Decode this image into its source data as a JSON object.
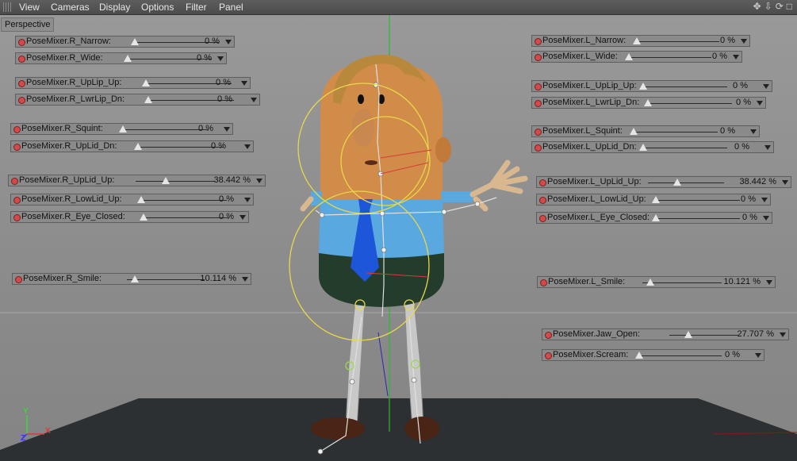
{
  "menubar": {
    "items": [
      "View",
      "Cameras",
      "Display",
      "Options",
      "Filter",
      "Panel"
    ],
    "nav_icons": [
      "move-view-icon",
      "dolly-view-icon",
      "rotate-view-icon",
      "maximize-view-icon"
    ]
  },
  "viewport": {
    "label": "Perspective",
    "axes": {
      "y": "Y",
      "x": "X",
      "z": "Z"
    }
  },
  "sliders": [
    {
      "id": "r-narrow",
      "label": "PoseMixer.R_Narrow:",
      "value": "0 %",
      "fraction": 0
    },
    {
      "id": "r-wide",
      "label": "PoseMixer.R_Wide:",
      "value": "0 %",
      "fraction": 0
    },
    {
      "id": "r-uplip-up",
      "label": "PoseMixer.R_UpLip_Up:",
      "value": "0 %",
      "fraction": 0
    },
    {
      "id": "r-lwrlip-dn",
      "label": "PoseMixer.R_LwrLip_Dn:",
      "value": "0 %",
      "fraction": 0
    },
    {
      "id": "r-squint",
      "label": "PoseMixer.R_Squint:",
      "value": "0 %",
      "fraction": 0
    },
    {
      "id": "r-uplid-dn",
      "label": "PoseMixer.R_UpLid_Dn:",
      "value": "0 %",
      "fraction": 0
    },
    {
      "id": "r-uplid-up",
      "label": "PoseMixer.R_UpLid_Up:",
      "value": "38.442 %",
      "fraction": 0.38442
    },
    {
      "id": "r-lowlid-up",
      "label": "PoseMixer.R_LowLid_Up:",
      "value": "0 %",
      "fraction": 0
    },
    {
      "id": "r-eye-closed",
      "label": "PoseMixer.R_Eye_Closed:",
      "value": "0 %",
      "fraction": 0
    },
    {
      "id": "r-smile",
      "label": "PoseMixer.R_Smile:",
      "value": "10.114 %",
      "fraction": 0.10114
    },
    {
      "id": "l-narrow",
      "label": "PoseMixer.L_Narrow:",
      "value": "0 %",
      "fraction": 0
    },
    {
      "id": "l-wide",
      "label": "PoseMixer.L_Wide:",
      "value": "0 %",
      "fraction": 0
    },
    {
      "id": "l-uplip-up",
      "label": "PoseMixer.L_UpLip_Up:",
      "value": "0 %",
      "fraction": 0
    },
    {
      "id": "l-lwrlip-dn",
      "label": "PoseMixer.L_LwrLip_Dn:",
      "value": "0 %",
      "fraction": 0
    },
    {
      "id": "l-squint",
      "label": "PoseMixer.L_Squint:",
      "value": "0 %",
      "fraction": 0
    },
    {
      "id": "l-uplid-dn",
      "label": "PoseMixer.L_UpLid_Dn:",
      "value": "0 %",
      "fraction": 0
    },
    {
      "id": "l-uplid-up",
      "label": "PoseMixer.L_UpLid_Up:",
      "value": "38.442 %",
      "fraction": 0.38442
    },
    {
      "id": "l-lowlid-up",
      "label": "PoseMixer.L_LowLid_Up:",
      "value": "0 %",
      "fraction": 0
    },
    {
      "id": "l-eye-closed",
      "label": "PoseMixer.L_Eye_Closed:",
      "value": "0 %",
      "fraction": 0
    },
    {
      "id": "l-smile",
      "label": "PoseMixer.L_Smile:",
      "value": "10.121 %",
      "fraction": 0.10121
    },
    {
      "id": "jaw-open",
      "label": "PoseMixer.Jaw_Open:",
      "value": "27.707 %",
      "fraction": 0.27707
    },
    {
      "id": "scream",
      "label": "PoseMixer.Scream:",
      "value": "0 %",
      "fraction": 0
    }
  ],
  "colors": {
    "menubar_text": "#e8e8e8",
    "viewport_bg": "#8c8c8c",
    "slider_bg": "#8a8a8a",
    "slider_dot": "#d34a4a",
    "floor": "#2c3032",
    "skin": "#d08c48",
    "shirt": "#5aa8e0",
    "tie": "#1d56d8",
    "pants": "#243c2c",
    "hair": "#b8883c",
    "ik_circle": "#e8d84a",
    "axis_x": "#d83a3a",
    "axis_y": "#3ad83a",
    "axis_z": "#3a3ad8"
  }
}
